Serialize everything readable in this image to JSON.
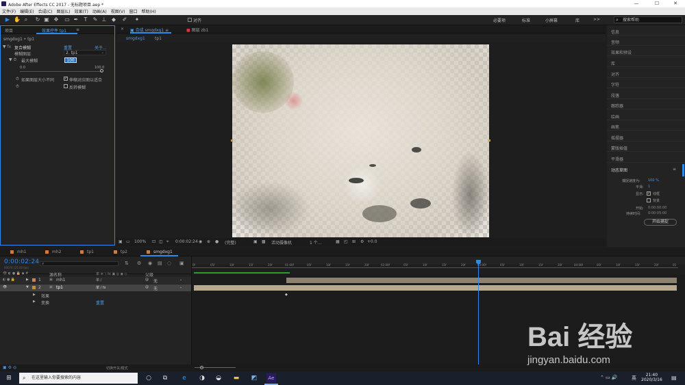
{
  "window": {
    "title": "Adobe After Effects CC 2017 - 无标题项目.aep *",
    "min": "—",
    "max": "☐",
    "close": "✕"
  },
  "menu": [
    "文件(F)",
    "编辑(E)",
    "合成(C)",
    "图层(L)",
    "效果(T)",
    "动画(A)",
    "视图(V)",
    "窗口",
    "帮助(H)"
  ],
  "toolbar": {
    "align_label": "对齐",
    "workspaces": [
      "必要项",
      "标准",
      "小屏幕",
      "库"
    ],
    "more": ">>",
    "help_placeholder": "搜索帮助"
  },
  "project_panel": {
    "tab_project": "项目",
    "tab_effects": "效果控件 tp1",
    "menu_icon": "≡",
    "breadcrumb": "smgdxg1 • tp1",
    "effect_name": "复合模糊",
    "reset": "重置",
    "about": "关于...",
    "blur_layer_label": "模糊图层",
    "blur_layer_value": "2. tp1",
    "max_blur_label": "最大模糊",
    "max_blur_value": "100",
    "slider_min": "0.0",
    "slider_max": "100.0",
    "layer_size_label": "如果图层大小不同",
    "stretch_label": "伸缩对应图以适合",
    "stretch_checked": true,
    "invert_label": "反转模糊",
    "invert_checked": false
  },
  "comp_panel": {
    "tab_comp": "合成 smgdxg1",
    "tab_layer": "图层 zb1",
    "subtab1": "smgdxg1",
    "subtab2": "tp1",
    "zoom": "100%",
    "timecode": "0:00:02:24",
    "resolution": "(完整)",
    "camera": "活动摄像机",
    "views": "1 个...",
    "exposure": "+0.0"
  },
  "right_panel": {
    "items": [
      "信息",
      "音频",
      "效果和预设",
      "库",
      "对齐",
      "字符",
      "段落",
      "跟踪器",
      "绘画",
      "画笔",
      "摇摆器",
      "蒙版插值",
      "平滑器"
    ],
    "motion_title": "动态草图",
    "capture_speed_label": "捕捉速度为:",
    "capture_speed_value": "100 %",
    "smooth_label": "平滑:",
    "smooth_value": "1",
    "show_label": "显示:",
    "wireframe_label": "线框",
    "wireframe_checked": true,
    "background_label": "背景",
    "background_checked": false,
    "start_label": "开始:",
    "start_value": "0:00:00:00",
    "duration_label": "持续时间:",
    "duration_value": "0:00:05:00",
    "start_button": "开始捕捉"
  },
  "timeline": {
    "tabs": [
      "mh1",
      "mh2",
      "tp1",
      "tp2",
      "smgdxg1"
    ],
    "timecode": "0:00:02:24",
    "fps": "00074 (25.00 fps)",
    "search_icon": "magnifier",
    "col_source": "源名称",
    "col_parent": "父级",
    "layers": [
      {
        "num": "1",
        "name": "mh1",
        "parent": "无"
      },
      {
        "num": "2",
        "name": "tp1",
        "parent": "无"
      }
    ],
    "effects_label": "效果",
    "transform_label": "变换",
    "transform_reset": "重置",
    "ruler_labels": [
      "0f",
      "05f",
      "10f",
      "15f",
      "20f",
      "01:00f",
      "05f",
      "10f",
      "15f",
      "20f",
      "02:00f",
      "05f",
      "10f",
      "15f",
      "20f",
      "03:00f",
      "05f",
      "10f",
      "15f",
      "20f",
      "04:00f",
      "05f",
      "10f",
      "15f",
      "20f",
      "05"
    ],
    "toggle_label": "切换开关/模式"
  },
  "taskbar": {
    "search_placeholder": "在这里输入你要搜索的内容",
    "time": "21:40",
    "date": "2020/3/16",
    "lang": "英"
  },
  "watermark": {
    "main": "Bai 经验",
    "url": "jingyan.baidu.com"
  },
  "colors": {
    "accent": "#2d8ceb",
    "panel": "#232323",
    "layer_bar": "#8d826f"
  }
}
